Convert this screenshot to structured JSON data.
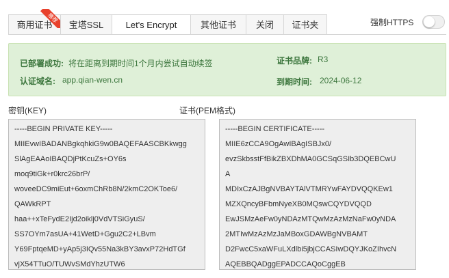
{
  "tabs": [
    {
      "label": "商用证书",
      "badge": "推荐",
      "active": false
    },
    {
      "label": "宝塔SSL",
      "active": false
    },
    {
      "label": "Let's Encrypt",
      "active": true
    },
    {
      "label": "其他证书",
      "active": false
    },
    {
      "label": "关闭",
      "active": false
    },
    {
      "label": "证书夹",
      "active": false
    }
  ],
  "https": {
    "label": "强制HTTPS",
    "enabled": false
  },
  "status": {
    "deploy_label": "已部署成功:",
    "deploy_value": "将在距离到期时间1个月内尝试自动续签",
    "domain_label": "认证域名:",
    "domain_value": "app.qian-wen.cn",
    "brand_label": "证书品牌:",
    "brand_value": "R3",
    "expire_label": "到期时间:",
    "expire_value": "2024-06-12"
  },
  "key": {
    "title": "密钥(KEY)",
    "lines": [
      "-----BEGIN PRIVATE KEY-----",
      "MIIEvwIBADANBgkqhkiG9w0BAQEFAASCBKkwgg",
      "SlAgEAAoIBAQDjPtKcuZs+OY6s",
      "moq9tiGk+r0krc26brP/",
      "woveeDC9miEut+6oxmChRb8N/2kmC2OKToe6/",
      "QAWkRPT",
      "haa++xTeFydE2Ijd2oiklj0VdVTSiGyuS/",
      "SS7OYm7asUA+41WetD+Ggu2C2+LBvm",
      "Y69FptqeMD+yAp5j3IQv55Na3kBY3avxP72HdTGf",
      "vjX54TTuO/TUWvSMdYhzUTW6"
    ]
  },
  "cert": {
    "title": "证书(PEM格式)",
    "lines": [
      "-----BEGIN CERTIFICATE-----",
      "MIIE6zCCA9OgAwIBAgISBJx0/",
      "evzSkbsstFfBikZBXDhMA0GCSqGSIb3DQEBCwU",
      "A",
      "MDIxCzAJBgNVBAYTAlVTMRYwFAYDVQQKEw1",
      "MZXQncyBFbmNyeXB0MQswCQYDVQQD",
      "EwJSMzAeFw0yNDAzMTQwMzAzMzNaFw0yNDA",
      "2MTIwMzAzMzJaMBoxGDAWBgNVBAMT",
      "D2FwcC5xaWFuLXdlbi5jbjCCASIwDQYJKoZIhvcN",
      "AQEBBQADggEPADCCAQoCggEB"
    ]
  }
}
